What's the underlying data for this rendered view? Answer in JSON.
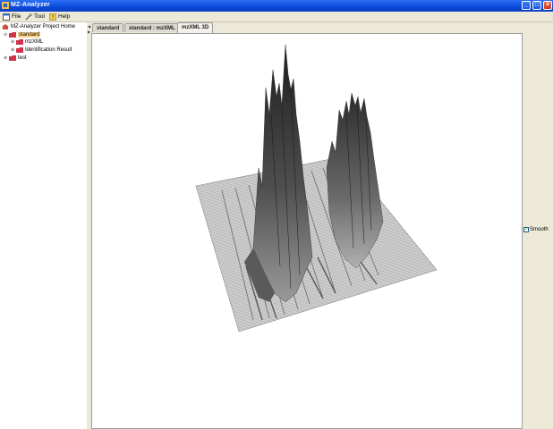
{
  "window": {
    "title": "MZ-Analyzer"
  },
  "menu": [
    {
      "label": "File",
      "icon": "file-icon"
    },
    {
      "label": "Tool",
      "icon": "tool-icon"
    },
    {
      "label": "Help",
      "icon": "help-icon"
    }
  ],
  "tree": {
    "root": "MZ-Analyzer Project Home",
    "items": [
      {
        "label": "standard",
        "level": 1,
        "expanded": true,
        "selected": true
      },
      {
        "label": "mzXML",
        "level": 2,
        "expanded": false,
        "selected": false
      },
      {
        "label": "Identification Result",
        "level": 2,
        "expanded": false,
        "selected": false
      },
      {
        "label": "test",
        "level": 1,
        "expanded": false,
        "selected": false
      }
    ]
  },
  "tabs": [
    {
      "label": "standard",
      "active": false
    },
    {
      "label": "standard : mzXML",
      "active": false
    },
    {
      "label": "mzXML 3D",
      "active": true
    }
  ],
  "options": {
    "smooth_label": "Smooth",
    "smooth_checked": true
  },
  "colors": {
    "titlebar": "#0a4ad8",
    "selection": "#ffd58a",
    "folder": "#d0324a"
  }
}
